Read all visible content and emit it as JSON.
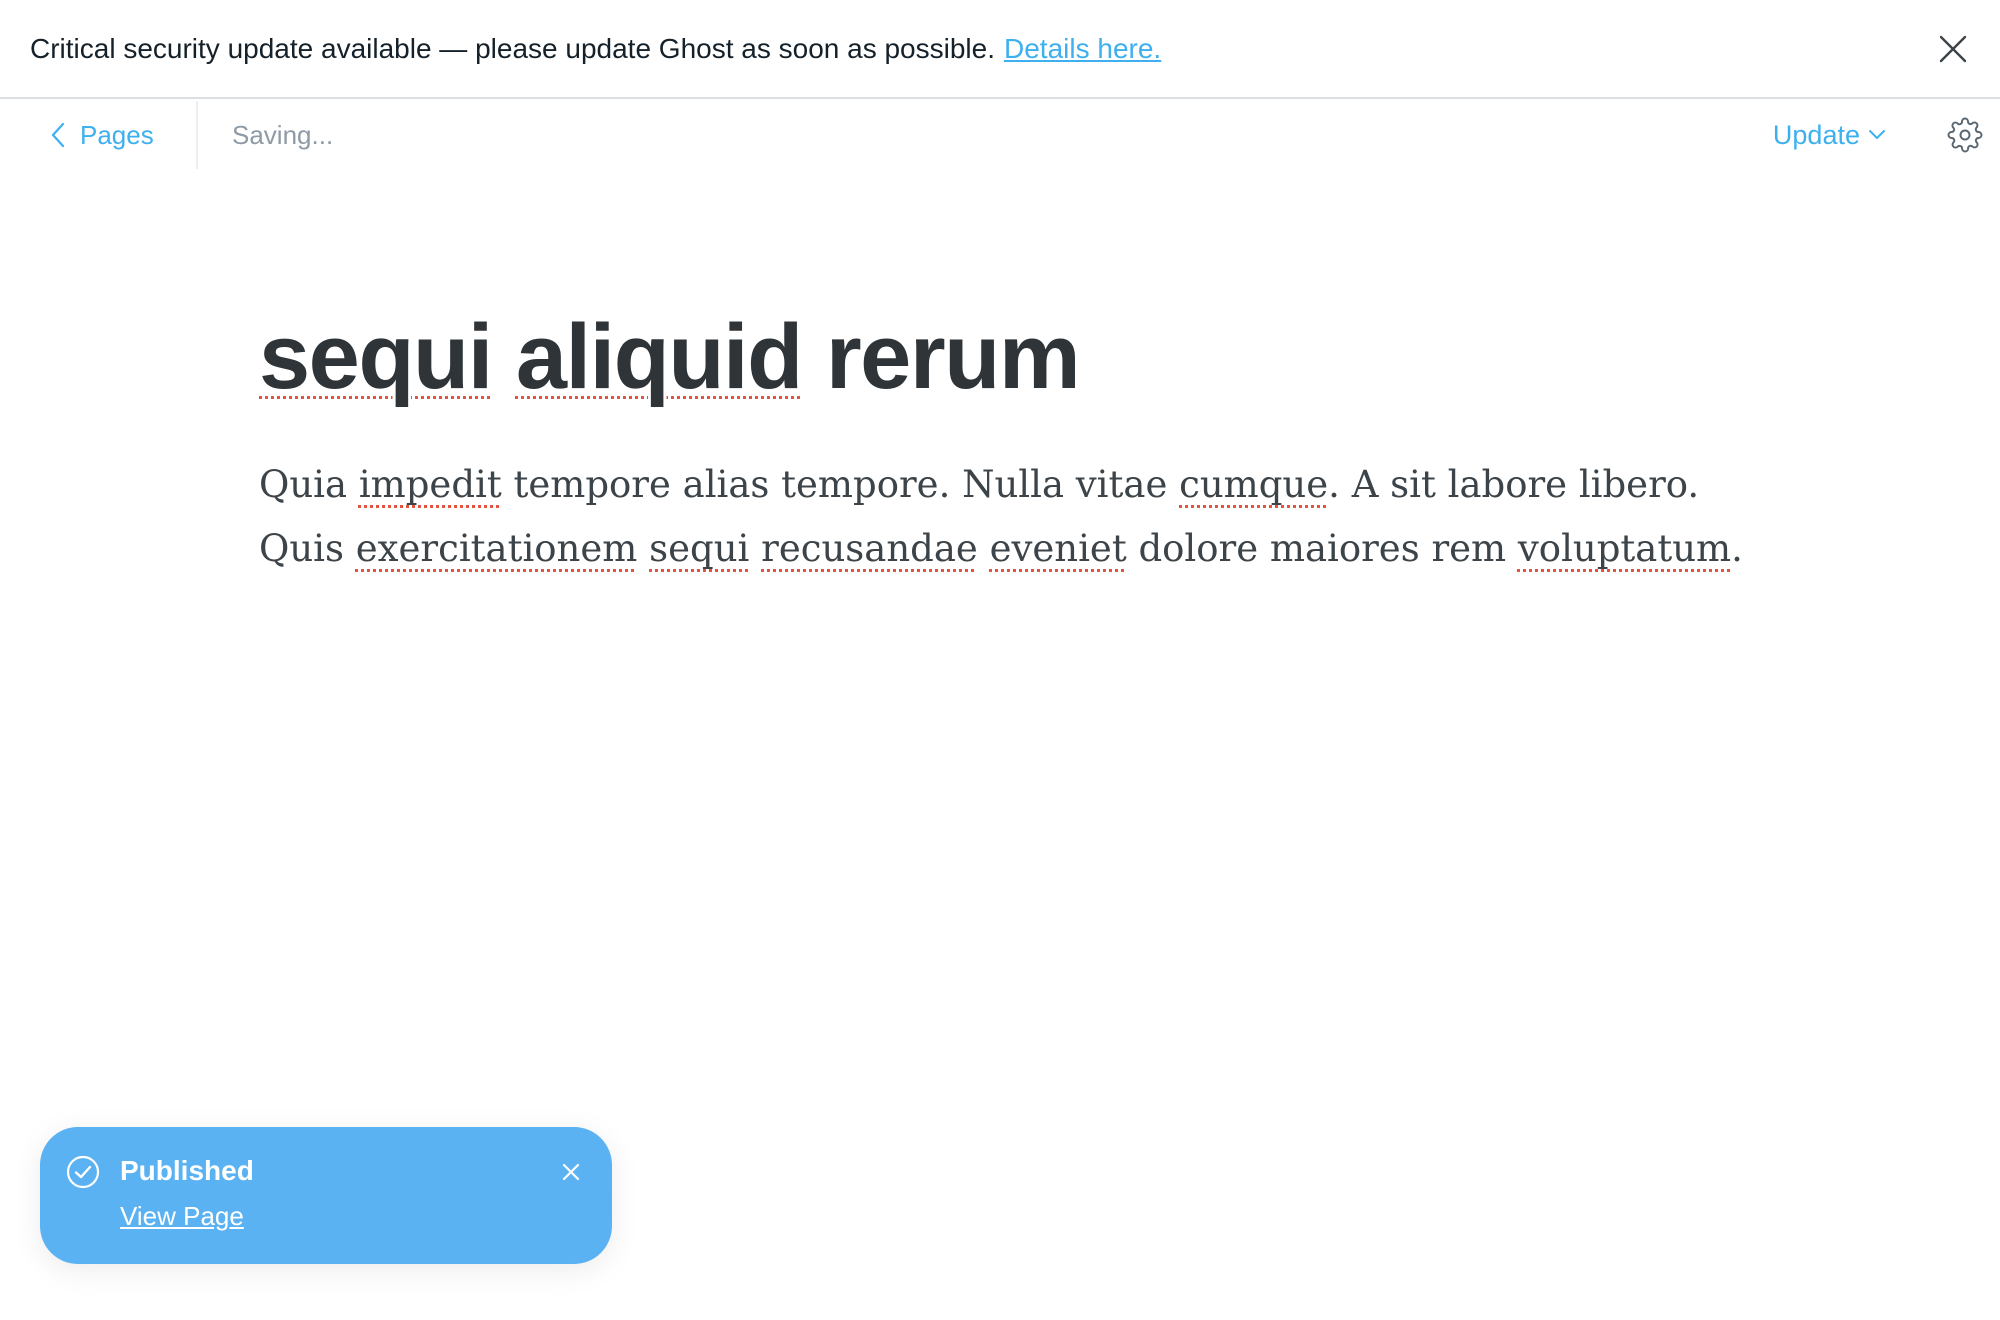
{
  "alert": {
    "message": "Critical security update available — please update Ghost as soon as possible.",
    "link_text": "Details here.",
    "close_icon": "close-icon"
  },
  "header": {
    "back_label": "Pages",
    "status": "Saving...",
    "publish_label": "Update",
    "settings_icon": "gear-icon"
  },
  "post": {
    "title_words": [
      "sequi",
      "aliquid",
      "rerum"
    ],
    "body_segments": [
      {
        "text": "Quia ",
        "spell": false
      },
      {
        "text": "impedit",
        "spell": true
      },
      {
        "text": " tempore alias tempore. Nulla vitae ",
        "spell": false
      },
      {
        "text": "cumque",
        "spell": true
      },
      {
        "text": ". A sit labore libero. Quis ",
        "spell": false
      },
      {
        "text": "exercitationem",
        "spell": true
      },
      {
        "text": " ",
        "spell": false
      },
      {
        "text": "sequi",
        "spell": true
      },
      {
        "text": " ",
        "spell": false
      },
      {
        "text": "recusandae",
        "spell": true
      },
      {
        "text": " ",
        "spell": false
      },
      {
        "text": "eveniet",
        "spell": true
      },
      {
        "text": " dolore maiores rem ",
        "spell": false
      },
      {
        "text": "voluptatum",
        "spell": true
      },
      {
        "text": ".",
        "spell": false
      }
    ]
  },
  "toast": {
    "title": "Published",
    "link_text": "View Page"
  },
  "colors": {
    "accent": "#3eb0ef",
    "toast_bg": "#5bb2f2",
    "spellcheck": "#e25440",
    "title_text": "#2e3438"
  }
}
